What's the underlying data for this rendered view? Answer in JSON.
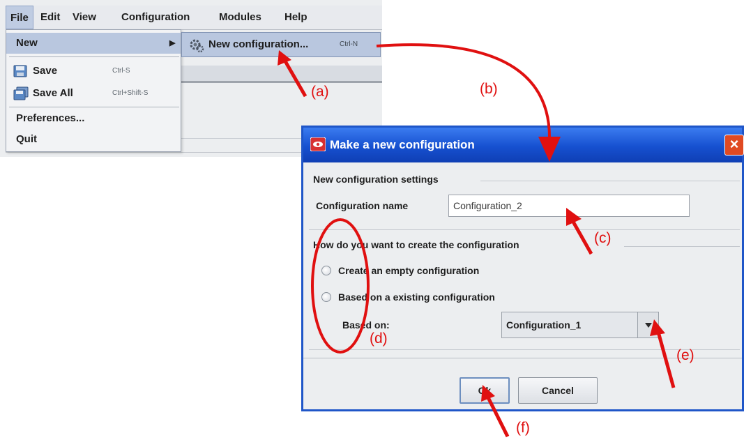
{
  "menubar": {
    "items": [
      "File",
      "Edit",
      "View",
      "Configuration",
      "Modules",
      "Help"
    ]
  },
  "file_menu": {
    "new": "New",
    "save": "Save",
    "save_shortcut": "Ctrl-S",
    "save_all": "Save All",
    "save_all_shortcut": "Ctrl+Shift-S",
    "preferences": "Preferences...",
    "quit": "Quit"
  },
  "submenu": {
    "new_configuration": "New configuration...",
    "shortcut": "Ctrl-N"
  },
  "dialog": {
    "title": "Make a new configuration",
    "close": "×",
    "settings_title": "New configuration settings",
    "name_label": "Configuration name",
    "name_value": "Configuration_2",
    "how_title": "How do you want to create the configuration",
    "option_empty": "Create an empty configuration",
    "option_based": "Based on a existing configuration",
    "based_on_label": "Based on:",
    "based_on_value": "Configuration_1",
    "ok": "Ok",
    "cancel": "Cancel"
  },
  "annotations": {
    "a": "(a)",
    "b": "(b)",
    "c": "(c)",
    "d": "(d)",
    "e": "(e)",
    "f": "(f)",
    "color": "#e01010"
  }
}
